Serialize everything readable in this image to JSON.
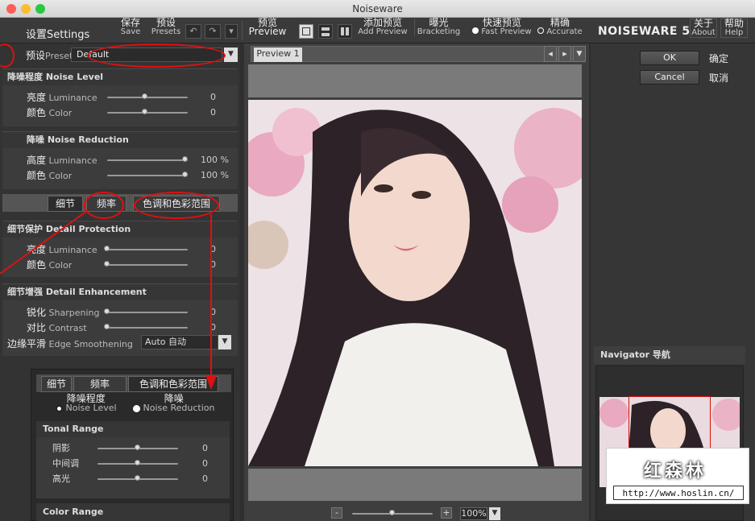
{
  "window": {
    "title": "Noiseware"
  },
  "toolbar": {
    "settings_label": "设置Settings",
    "save_cn": "保存",
    "save_en": "Save",
    "presets_cn": "预设",
    "presets_en": "Presets",
    "undo_icon": "undo-icon",
    "redo_icon": "redo-icon",
    "preview_cn": "预览",
    "preview_en": "Preview",
    "add_preview_cn": "添加预览",
    "add_preview_en": "Add Preview",
    "bracketing_cn": "曝光",
    "bracketing_en": "Bracketing",
    "fast_preview_cn": "快速预览",
    "fast_preview_en": "Fast Preview",
    "accurate_cn": "精确",
    "accurate_en": "Accurate",
    "brand": "NOISEWARE 5",
    "about_cn": "关于",
    "about_en": "About",
    "help_cn": "帮助",
    "help_en": "Help"
  },
  "preset": {
    "label_cn": "预设",
    "label_en": "Preset",
    "value": "Default"
  },
  "noise_level": {
    "title": "降噪程度 Noise Level",
    "rows": [
      {
        "cn": "亮度",
        "en": "Luminance",
        "value": "0",
        "pos": 0.5
      },
      {
        "cn": "颜色",
        "en": "Color",
        "value": "0",
        "pos": 0.5
      }
    ]
  },
  "noise_reduction": {
    "title": "降噪 Noise Reduction",
    "rows": [
      {
        "cn": "高度",
        "en": "Luminance",
        "value": "100",
        "unit": "%",
        "pos": 1.0
      },
      {
        "cn": "颜色",
        "en": "Color",
        "value": "100",
        "unit": "%",
        "pos": 1.0
      }
    ]
  },
  "tabs": [
    "细节",
    "频率",
    "色调和色彩范围"
  ],
  "detail_protection": {
    "title": "细节保护 Detail Protection",
    "rows": [
      {
        "cn": "亮度",
        "en": "Luminance",
        "value": "0",
        "pos": 0
      },
      {
        "cn": "颜色",
        "en": "Color",
        "value": "0",
        "pos": 0
      }
    ]
  },
  "detail_enhancement": {
    "title": "细节增强 Detail Enhancement",
    "rows": [
      {
        "cn": "锐化",
        "en": "Sharpening",
        "value": "0",
        "pos": 0
      },
      {
        "cn": "对比",
        "en": "Contrast",
        "value": "0",
        "pos": 0
      }
    ],
    "edge_cn": "边缘平滑",
    "edge_en": "Edge Smoothening",
    "edge_value": "Auto 自动"
  },
  "inset": {
    "tabs": [
      "细节",
      "频率",
      "色调和色彩范围"
    ],
    "radio_noise_cn": "降噪程度",
    "radio_noise_en": "Noise Level",
    "radio_reduction_cn": "降噪",
    "radio_reduction_en": "Noise Reduction",
    "tonal_title": "Tonal Range",
    "tonal_rows": [
      {
        "label": "阴影",
        "value": "0",
        "pos": 0.5
      },
      {
        "label": "中间调",
        "value": "0",
        "pos": 0.5
      },
      {
        "label": "高光",
        "value": "0",
        "pos": 0.5
      }
    ],
    "color_title": "Color Range"
  },
  "preview_tab": "Preview 1",
  "zoom": {
    "value": "100%",
    "minus": "-",
    "plus": "+",
    "pos": 0.5
  },
  "ok": {
    "label": "OK",
    "cn": "确定"
  },
  "cancel": {
    "label": "Cancel",
    "cn": "取消"
  },
  "navigator": {
    "title": "Navigator 导航"
  },
  "watermark": {
    "text": "红森林",
    "url": "http://www.hoslin.cn/"
  },
  "colors": {
    "annotation": "#dd1111",
    "panel": "#333333"
  }
}
